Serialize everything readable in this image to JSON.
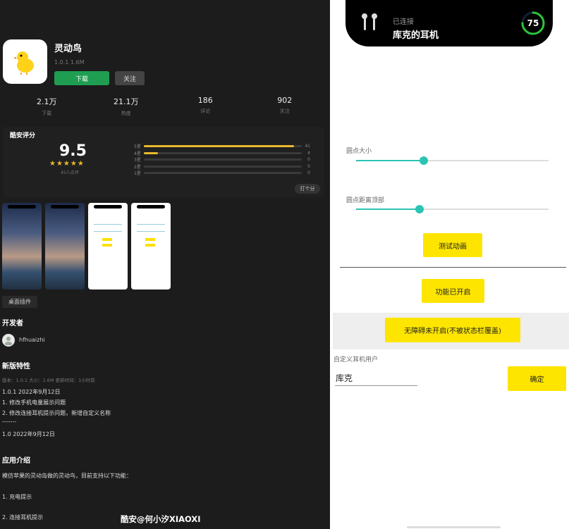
{
  "app": {
    "name": "灵动鸟",
    "meta": "1.0.1  1.6M",
    "download_label": "下载",
    "follow_label": "关注"
  },
  "stats": [
    {
      "value": "2.1万",
      "label": "下载"
    },
    {
      "value": "21.1万",
      "label": "热度"
    },
    {
      "value": "186",
      "label": "评论"
    },
    {
      "value": "902",
      "label": "关注"
    }
  ],
  "rating": {
    "title": "酷安评分",
    "score": "9.5",
    "stars": "★★★★★",
    "raters": "45人点评",
    "rows": [
      {
        "label": "5星",
        "count": "41",
        "fraction": 0.95
      },
      {
        "label": "4星",
        "count": "4",
        "fraction": 0.09
      },
      {
        "label": "3星",
        "count": "0",
        "fraction": 0.0
      },
      {
        "label": "2星",
        "count": "0",
        "fraction": 0.0
      },
      {
        "label": "1星",
        "count": "0",
        "fraction": 0.0
      }
    ],
    "rate_button": "打个分"
  },
  "widget_tag": "桌面插件",
  "developer": {
    "title": "开发者",
    "name": "hfhuaizhi"
  },
  "changelog": {
    "title": "新版特性",
    "meta": "版本：1.0.1   大小：1.6M   更新时间：1小时前",
    "lines": [
      "1.0.1 2022年9月12日",
      "1. 修改手机电量展示问题",
      "2. 修改连接耳机提示问题，新增自定义名称",
      "-------",
      "1.0 2022年9月12日"
    ]
  },
  "intro": {
    "title": "应用介绍",
    "desc": "模仿苹果的灵动岛做的灵动鸟，目前支持以下功能：",
    "item1": "1. 充电提示",
    "item2": "2. 连接耳机提示"
  },
  "watermark": "酷安@何小汐XIAOXI",
  "island": {
    "state": "已连接",
    "device": "库克的耳机",
    "battery": "75",
    "battery_level": 0.75,
    "ring_color": "#2bc43a"
  },
  "settings": {
    "dot_size_label": "圆点大小",
    "dot_size_level": 0.35,
    "dot_top_label": "圆点距离顶部",
    "dot_top_level": 0.33,
    "test_button": "测试动画",
    "feature_button": "功能已开启",
    "accessibility_button": "无障碍未开启(不被状态栏覆盖)",
    "custom_label": "自定义耳机用户",
    "custom_value": "库克",
    "confirm_button": "确定",
    "accent": "#2bc4b4",
    "button_color": "#fde500"
  }
}
